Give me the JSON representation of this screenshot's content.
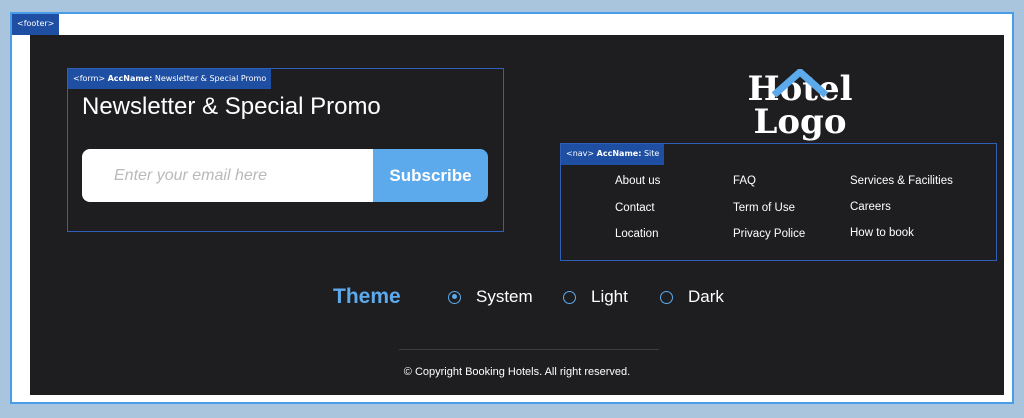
{
  "footer": {
    "tag": "<footer>"
  },
  "newsletter": {
    "tag_element": "<form>",
    "tag_accname_key": "AccName:",
    "tag_accname_value": "Newsletter & Special Promo",
    "title": "Newsletter & Special Promo",
    "email_placeholder": "Enter your email here",
    "subscribe_label": "Subscribe"
  },
  "logo": {
    "line1": "Hotel",
    "line2": "Logo",
    "accent_color": "#5ca9ec",
    "icon": "roof-icon"
  },
  "site_nav": {
    "tag_element": "<nav>",
    "tag_accname_key": "AccName:",
    "tag_accname_value": "Site",
    "columns": [
      [
        "About us",
        "Contact",
        "Location"
      ],
      [
        "FAQ",
        "Term of Use",
        "Privacy Police"
      ],
      [
        "Services & Facilities",
        "Careers",
        "How to book"
      ]
    ]
  },
  "theme": {
    "label": "Theme",
    "options": [
      {
        "label": "System",
        "selected": true
      },
      {
        "label": "Light",
        "selected": false
      },
      {
        "label": "Dark",
        "selected": false
      }
    ]
  },
  "copyright": "© Copyright Booking Hotels. All right reserved.",
  "colors": {
    "footer_bg": "#1e1e20",
    "accent": "#5ca9ec",
    "annotation": "#1f4fa3",
    "page_bg": "#a9c4dd"
  }
}
